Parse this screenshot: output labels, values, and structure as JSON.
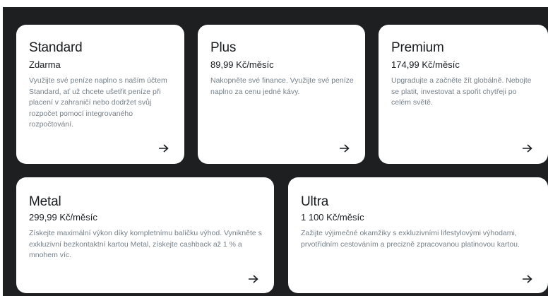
{
  "plans": {
    "standard": {
      "name": "Standard",
      "price": "Zdarma",
      "description": "Využijte své peníze naplno s naším účtem Standard, ať už chcete ušetřit peníze při placení v zahraničí nebo dodržet svůj rozpočet pomocí integrovaného rozpočtování."
    },
    "plus": {
      "name": "Plus",
      "price": "89,99 Kč/měsíc",
      "description": "Nakopněte své finance. Využijte své peníze naplno za cenu jedné kávy."
    },
    "premium": {
      "name": "Premium",
      "price": "174,99 Kč/měsíc",
      "description": "Upgradujte a začněte žít globálně. Nebojte se platit, investovat a spořit chytřeji po celém světě."
    },
    "metal": {
      "name": "Metal",
      "price": "299,99 Kč/měsíc",
      "description": "Získejte maximální výkon díky kompletnímu balíčku výhod. Vynikněte s exkluzivní bezkontaktní kartou Metal, získejte cashback až 1 % a mnohem víc."
    },
    "ultra": {
      "name": "Ultra",
      "price": "1 100 Kč/měsíc",
      "description": "Zažijte výjimečné okamžiky s exkluzivními lifestylovými výhodami, prvotřídním cestováním a precizně zpracovanou platinovou kartou."
    }
  },
  "icons": {
    "arrow": "arrow-right-icon"
  },
  "colors": {
    "background": "#1d1f21",
    "card": "#ffffff",
    "text": "#191c1f",
    "muted": "#75808a"
  }
}
